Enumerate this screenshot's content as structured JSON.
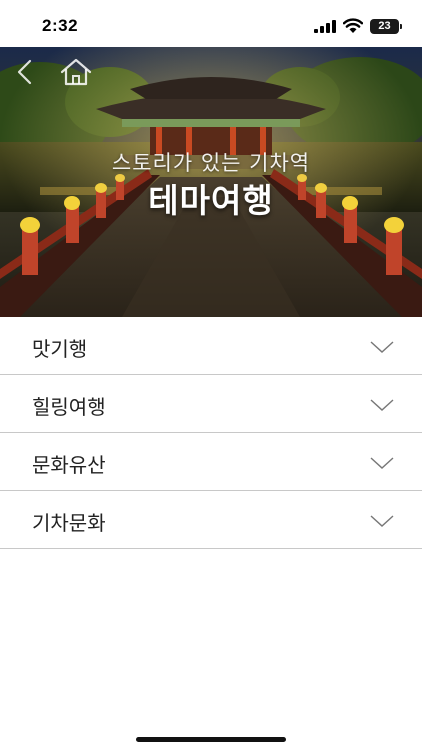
{
  "status_bar": {
    "time": "2:32",
    "battery": "23",
    "icons": [
      "signal-icon",
      "wifi-icon",
      "battery-icon"
    ]
  },
  "hero": {
    "subtitle": "스토리가 있는 기차역",
    "title": "테마여행",
    "icons": [
      "back-arrow-icon",
      "home-icon"
    ]
  },
  "menu": {
    "items": [
      {
        "label": "맛기행"
      },
      {
        "label": "힐링여행"
      },
      {
        "label": "문화유산"
      },
      {
        "label": "기차문화"
      }
    ],
    "icon": "chevron-down-icon"
  },
  "colors": {
    "divider": "#c8c8c8",
    "text": "#222222",
    "chevron": "#777777"
  }
}
